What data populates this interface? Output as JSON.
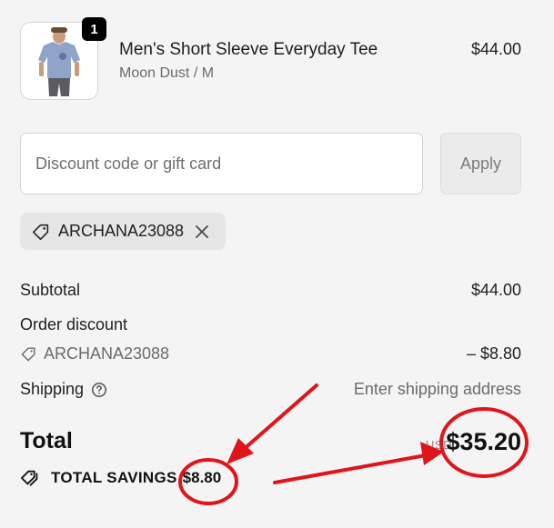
{
  "product": {
    "quantity": "1",
    "name": "Men's Short Sleeve Everyday Tee",
    "variant": "Moon Dust / M",
    "price": "$44.00",
    "image_icon": "tshirt-product-image"
  },
  "discount": {
    "placeholder": "Discount code or gift card",
    "value": "",
    "apply_label": "Apply"
  },
  "applied_code": {
    "code": "ARCHANA23088",
    "tag_icon": "tag-icon",
    "remove_icon": "close-icon"
  },
  "summary": {
    "subtotal_label": "Subtotal",
    "subtotal_value": "$44.00",
    "order_discount_label": "Order discount",
    "discount_code": "ARCHANA23088",
    "discount_value": "– $8.80",
    "shipping_label": "Shipping",
    "shipping_value": "Enter shipping address",
    "total_label": "Total",
    "currency": "USD",
    "total_value": "$35.20",
    "savings_label": "TOTAL SAVINGS",
    "savings_value": "$8.80"
  },
  "annotation": {
    "color": "#e0151b"
  }
}
